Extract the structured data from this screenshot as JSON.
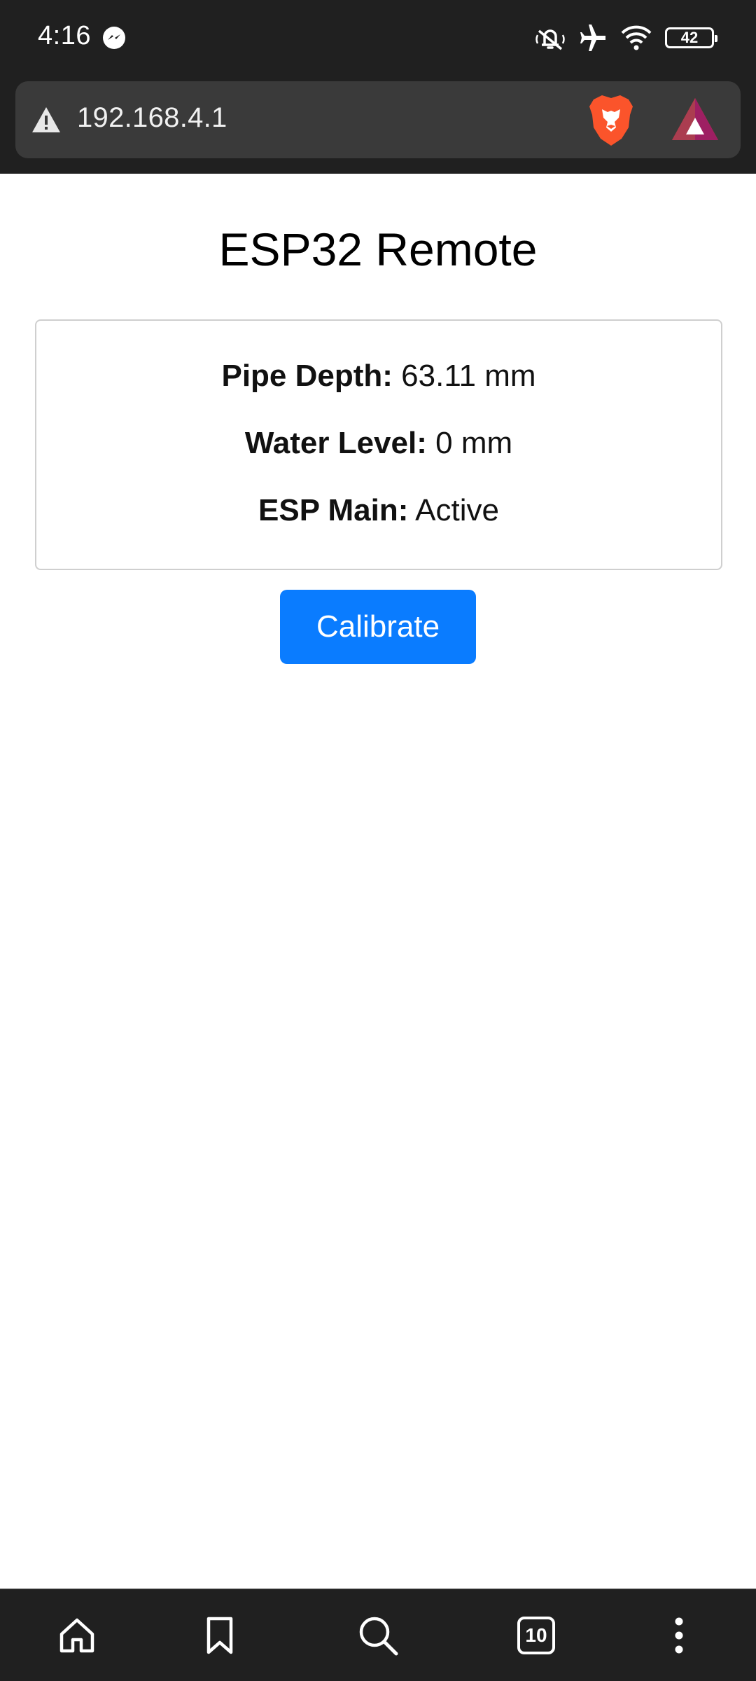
{
  "status_bar": {
    "time": "4:16",
    "battery_level": "42",
    "icons": [
      "messenger-icon",
      "mute-icon",
      "airplane-icon",
      "wifi-icon",
      "battery-icon"
    ]
  },
  "browser": {
    "url": "192.168.4.1",
    "security_icon": "warning-icon",
    "extension_icons": [
      "brave-shields-icon",
      "brave-rewards-icon"
    ],
    "tab_count": "10",
    "nav_icons": [
      "home-icon",
      "bookmark-icon",
      "search-icon",
      "tabs-icon",
      "menu-icon"
    ]
  },
  "page": {
    "title": "ESP32 Remote",
    "rows": [
      {
        "label": "Pipe Depth:",
        "value": "63.11 mm"
      },
      {
        "label": "Water Level:",
        "value": "0 mm"
      },
      {
        "label": "ESP Main:",
        "value": "Active"
      }
    ],
    "calibrate_label": "Calibrate"
  },
  "colors": {
    "button": "#0a7cff",
    "chrome": "#202020",
    "url_box": "#3a3a3a"
  }
}
